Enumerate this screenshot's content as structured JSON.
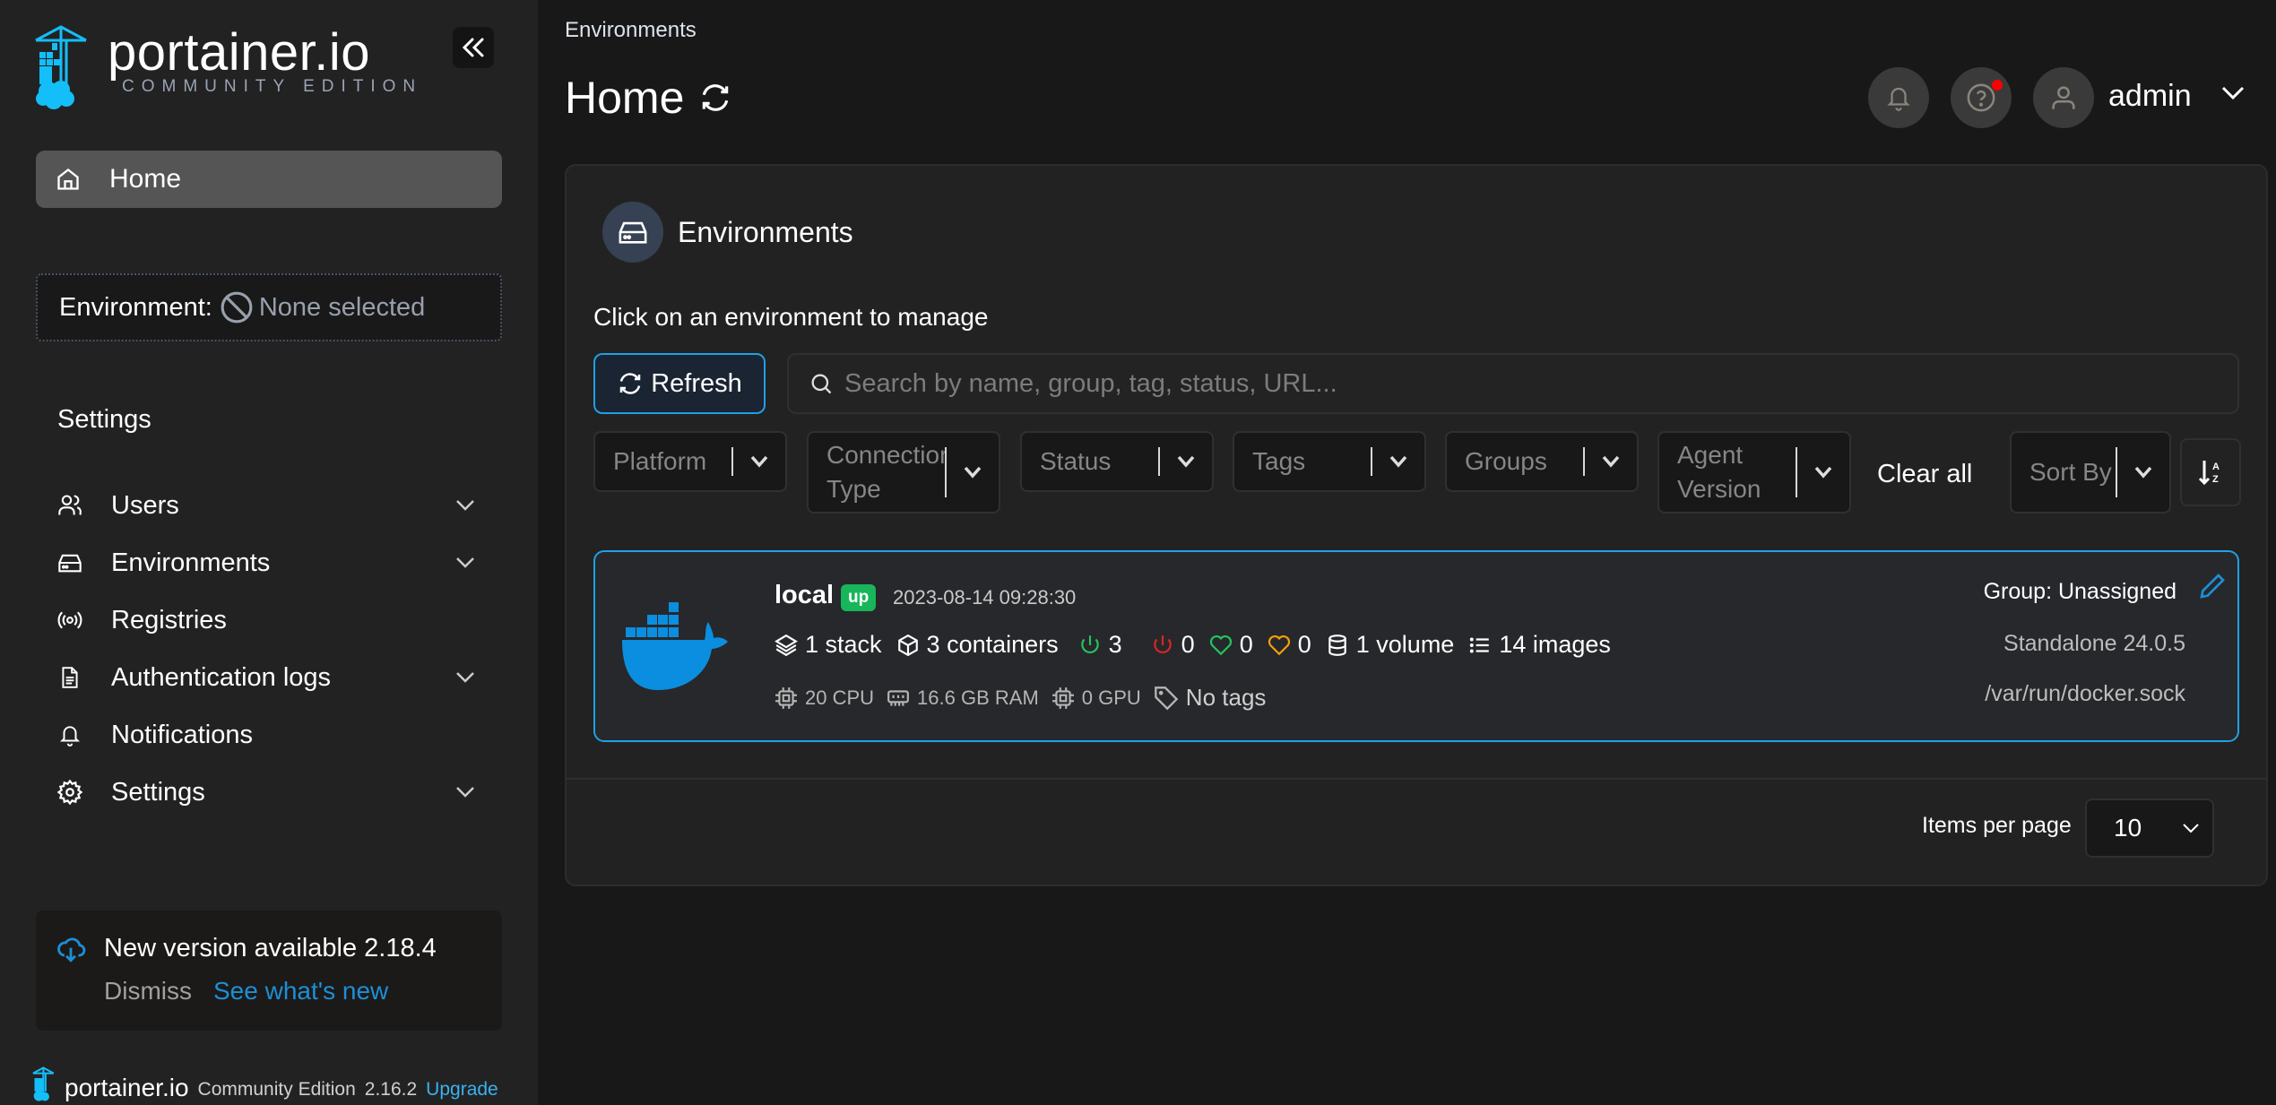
{
  "sidebar": {
    "logo": {
      "name": "portainer.io",
      "edition": "COMMUNITY EDITION"
    },
    "home_label": "Home",
    "environment": {
      "label": "Environment:",
      "value": "None selected"
    },
    "section_title": "Settings",
    "items": [
      {
        "label": "Users",
        "icon": "users-icon",
        "expandable": true
      },
      {
        "label": "Environments",
        "icon": "hard-drive-icon",
        "expandable": true
      },
      {
        "label": "Registries",
        "icon": "radio-icon",
        "expandable": false
      },
      {
        "label": "Authentication logs",
        "icon": "file-text-icon",
        "expandable": true
      },
      {
        "label": "Notifications",
        "icon": "bell-icon",
        "expandable": false
      },
      {
        "label": "Settings",
        "icon": "gear-icon",
        "expandable": true
      }
    ],
    "update": {
      "title": "New version available 2.18.4",
      "dismiss": "Dismiss",
      "see_new": "See what's new"
    },
    "footer": {
      "brand": "portainer.io",
      "edition": "Community Edition",
      "version": "2.16.2",
      "upgrade": "Upgrade"
    }
  },
  "header": {
    "breadcrumb": "Environments",
    "title": "Home",
    "user": "admin"
  },
  "panel": {
    "title": "Environments",
    "hint": "Click on an environment to manage",
    "refresh_label": "Refresh",
    "search_placeholder": "Search by name, group, tag, status, URL...",
    "filters": [
      {
        "label": "Platform"
      },
      {
        "label": "Connection Type"
      },
      {
        "label": "Status"
      },
      {
        "label": "Tags"
      },
      {
        "label": "Groups"
      },
      {
        "label": "Agent Version"
      }
    ],
    "clear_all": "Clear all",
    "sort_by": "Sort By",
    "environments": [
      {
        "name": "local",
        "status": "up",
        "timestamp": "2023-08-14 09:28:30",
        "stacks": "1 stack",
        "containers": "3 containers",
        "running": "3",
        "stopped": "0",
        "healthy": "0",
        "unhealthy": "0",
        "volumes": "1 volume",
        "images": "14 images",
        "cpu": "20 CPU",
        "ram": "16.6 GB RAM",
        "gpu": "0 GPU",
        "tags": "No tags",
        "group": "Group: Unassigned",
        "type": "Standalone 24.0.5",
        "url": "/var/run/docker.sock"
      }
    ],
    "items_per_page_label": "Items per page",
    "items_per_page": "10"
  },
  "colors": {
    "accent": "#1fa0e6",
    "up_badge": "#17b65a",
    "running": "#22c55e",
    "stopped": "#dc2626",
    "healthy": "#22c55e",
    "unhealthy": "#f59e0b",
    "docker_blue": "#0b8ee0"
  }
}
